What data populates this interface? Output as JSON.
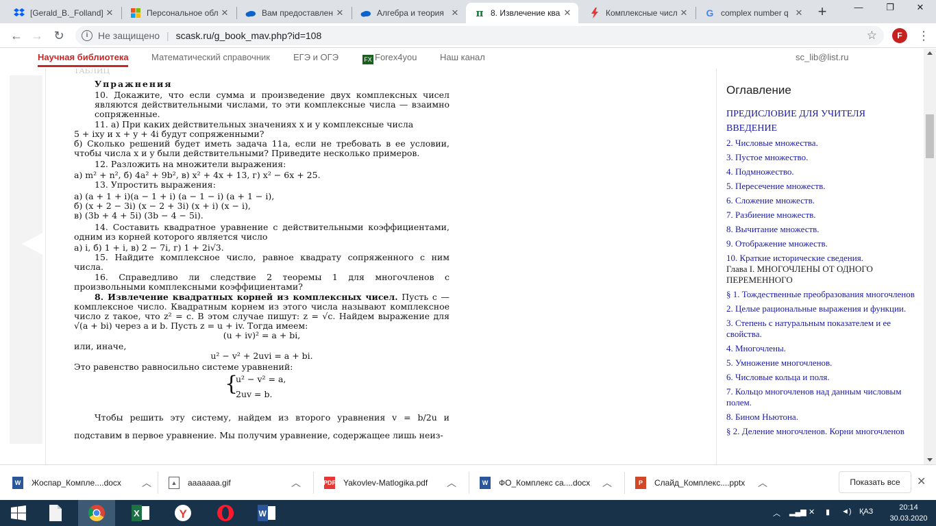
{
  "tabs": [
    {
      "title": "[Gerald_B._Folland]",
      "icon": "dropbox-icon"
    },
    {
      "title": "Персональное обл",
      "icon": "microsoft-icon"
    },
    {
      "title": "Вам предоставлен",
      "icon": "onedrive-cloud-icon"
    },
    {
      "title": "Алгебра и теория",
      "icon": "onedrive-cloud-icon"
    },
    {
      "title": "8. Извлечение ква",
      "icon": "pi-icon",
      "active": true
    },
    {
      "title": "Комплексные числ",
      "icon": "lightning-icon"
    },
    {
      "title": "complex number q",
      "icon": "google-icon"
    }
  ],
  "address": {
    "security": "Не защищено",
    "url": "scask.ru/g_book_mav.php?id=108"
  },
  "profile_initial": "F",
  "site_nav": {
    "items": [
      "Научная библиотека",
      "Математический справочник",
      "ЕГЭ и ОГЭ",
      "Forex4you",
      "Наш канал"
    ],
    "email": "sc_lib@list.ru"
  },
  "book": {
    "faded_top": "ТАБЛИЦ",
    "heading": "Упражнения",
    "p10": "10. Докажите, что если сумма и произведение двух комплексных чисел являются действительными числами, то эти комплексные числа — взаимно сопряженные.",
    "p11a_1": "11. а) При каких действительных значениях x и y комплексные числа",
    "p11a_2": "5 + ixy и x + y + 4i будут сопряженными?",
    "p11b": "б) Сколько решений будет иметь задача 11а, если не требовать в ее условии, чтобы числа x и y были действительными? Приведите несколько примеров.",
    "p12": "12. Разложить на множители выражения:",
    "p12_items": "а) m² + n²,   б) 4a² + 9b²,   в) x² + 4x + 13,   г) x² − 6x + 25.",
    "p13": "13. Упростить выражения:",
    "p13_a": "а) (a + 1 + i)(a − 1 + i) (a − 1 − i) (a + 1 − i),",
    "p13_b": "б) (x + 2 − 3i) (x − 2 + 3i) (x + i) (x − i),",
    "p13_c": "в) (3b + 4 + 5i) (3b − 4 − 5i).",
    "p14": "14. Составить квадратное уравнение с действительными коэффициентами, одним из корней которого является число",
    "p14_items": "а) i,  б) 1 + i,  в) 2 − 7i,  г) 1 + 2i√3.",
    "p15": "15. Найдите комплексное число, равное квадрату сопряженного с ним числа.",
    "p16": "16. Справедливо ли следствие 2 теоремы 1 для многочленов с произвольными комплексными коэффициентами?",
    "s8_title": "8. Извлечение квадратных корней из комплексных чисел.",
    "s8_body": "Пусть c — комплексное число. Квадратным корнем из этого числа называют комплексное число z такое, что z² = c. В этом случае пишут: z = √c. Найдем выражение для √(a + bi) через a и b. Пусть z = u + iv. Тогда имеем:",
    "eq1": "(u + iv)² = a + bi,",
    "or_else": "или, иначе,",
    "eq2": "u² − v² + 2uvi = a + bi.",
    "equivalent": "Это равенство равносильно системе уравнений:",
    "sys1": "u² − v² = a,",
    "sys2": "2uv = b.",
    "solve_1": "Чтобы решить эту систему, найдем из второго уравнения v = b/2u и подставим в первое уравнение. Мы получим уравнение, содержащее лишь неиз-"
  },
  "toc": {
    "title": "Оглавление",
    "items": [
      {
        "text": "ПРЕДИСЛОВИЕ ДЛЯ УЧИТЕЛЯ",
        "type": "big"
      },
      {
        "text": "ВВЕДЕНИЕ",
        "type": "big"
      },
      {
        "text": "2. Числовые множества.",
        "type": "link"
      },
      {
        "text": "3. Пустое множество.",
        "type": "link"
      },
      {
        "text": "4. Подмножество.",
        "type": "link"
      },
      {
        "text": "5. Пересечение множеств.",
        "type": "link"
      },
      {
        "text": "6. Сложение множеств.",
        "type": "link"
      },
      {
        "text": "7. Разбиение множеств.",
        "type": "link"
      },
      {
        "text": "8. Вычитание множеств.",
        "type": "link"
      },
      {
        "text": "9. Отображение множеств.",
        "type": "link"
      },
      {
        "text": "10. Краткие исторические сведения.",
        "type": "link"
      },
      {
        "text": "Глава I. МНОГОЧЛЕНЫ ОТ ОДНОГО ПЕРЕМЕННОГО",
        "type": "head"
      },
      {
        "text": "§ 1. Тождественные преобразования многочленов",
        "type": "link"
      },
      {
        "text": "2. Целые рациональные выражения и функции.",
        "type": "link"
      },
      {
        "text": "3. Степень с натуральным показателем и ее свойства.",
        "type": "link"
      },
      {
        "text": "4. Многочлены.",
        "type": "link"
      },
      {
        "text": "5. Умножение многочленов.",
        "type": "link"
      },
      {
        "text": "6. Числовые кольца и поля.",
        "type": "link"
      },
      {
        "text": "7. Кольцо многочленов над данным числовым полем.",
        "type": "link"
      },
      {
        "text": "8. Бином Ньютона.",
        "type": "link"
      },
      {
        "text": "§ 2. Деление многочленов. Корни многочленов",
        "type": "link"
      }
    ]
  },
  "downloads": [
    {
      "name": "Жоспар_Компле....docx",
      "icon": "word-file-icon"
    },
    {
      "name": "ааааааа.gif",
      "icon": "image-file-icon"
    },
    {
      "name": "Yakovlev-Matlogika.pdf",
      "icon": "pdf-file-icon"
    },
    {
      "name": "ФО_Комплекс са....docx",
      "icon": "word-file-icon"
    },
    {
      "name": "Слайд_Комплекс....pptx",
      "icon": "powerpoint-file-icon"
    }
  ],
  "downloads_show_all": "Показать все",
  "taskbar": {
    "apps": [
      "start",
      "file",
      "chrome",
      "excel",
      "yandex",
      "opera",
      "word"
    ],
    "lang": "ҚАЗ",
    "time": "20:14",
    "date": "30.03.2020"
  },
  "colors": {
    "accent_red": "#c62828",
    "link_blue": "#1a1aa6",
    "taskbar": "#18324a"
  }
}
